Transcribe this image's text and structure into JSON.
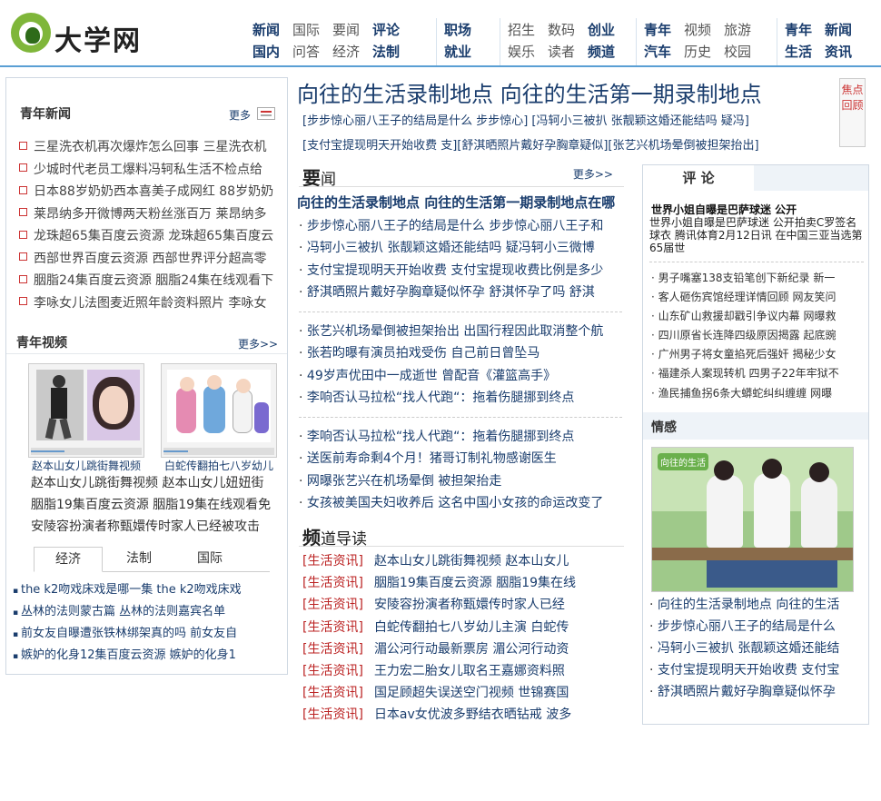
{
  "header": {
    "logo_text": "大学网",
    "nav_cols": [
      {
        "row1": [
          {
            "t": "新闻",
            "b": true
          },
          {
            "t": "国际",
            "b": false
          },
          {
            "t": "要闻",
            "b": false
          },
          {
            "t": "评论",
            "b": true
          }
        ],
        "row2": [
          {
            "t": "国内",
            "b": true
          },
          {
            "t": "问答",
            "b": false
          },
          {
            "t": "经济",
            "b": false
          },
          {
            "t": "法制",
            "b": true
          }
        ]
      },
      {
        "row1": [
          {
            "t": "职场",
            "b": true
          }
        ],
        "row2": [
          {
            "t": "就业",
            "b": true
          }
        ]
      },
      {
        "row1": [
          {
            "t": "招生",
            "b": false
          },
          {
            "t": "数码",
            "b": false
          },
          {
            "t": "创业",
            "b": true
          }
        ],
        "row2": [
          {
            "t": "娱乐",
            "b": false
          },
          {
            "t": "读者",
            "b": false
          },
          {
            "t": "频道",
            "b": true
          }
        ]
      },
      {
        "row1": [
          {
            "t": "青年",
            "b": true
          },
          {
            "t": "视频",
            "b": false
          },
          {
            "t": "旅游",
            "b": false
          }
        ],
        "row2": [
          {
            "t": "汽车",
            "b": true
          },
          {
            "t": "历史",
            "b": false
          },
          {
            "t": "校园",
            "b": false
          }
        ]
      },
      {
        "row1": [
          {
            "t": "青年",
            "b": true
          },
          {
            "t": "新闻",
            "b": true
          }
        ],
        "row2": [
          {
            "t": "生活",
            "b": true
          },
          {
            "t": "资讯",
            "b": true
          }
        ]
      }
    ]
  },
  "left": {
    "youth_news": {
      "title": "青年新闻",
      "more": "更多",
      "items": [
        "三星洗衣机再次爆炸怎么回事 三星洗衣机",
        "少城时代老员工爆料冯轲私生活不检点给",
        "日本88岁奶奶西本喜美子成网红 88岁奶奶",
        "莱昂纳多开微博两天粉丝涨百万 莱昂纳多",
        "龙珠超65集百度云资源 龙珠超65集百度云",
        "西部世界百度云资源 西部世界评分超高零",
        "胭脂24集百度云资源 胭脂24集在线观看下",
        "李咏女儿法图麦近照年龄资料照片 李咏女"
      ]
    },
    "youth_video": {
      "title": "青年视频",
      "more": "更多>>",
      "captions": [
        "赵本山女儿跳街舞视频",
        "白蛇传翻拍七八岁幼儿"
      ],
      "text_lines": [
        "赵本山女儿跳街舞视频 赵本山女儿妞妞街",
        "胭脂19集百度云资源 胭脂19集在线观看免",
        "安陵容扮演者称甄嬛传时家人已经被攻击"
      ]
    },
    "tabs": [
      "经济",
      "法制",
      "国际"
    ],
    "tab_items": [
      "the k2吻戏床戏是哪一集 the k2吻戏床戏",
      "丛林的法则蒙古篇 丛林的法则嘉宾名单",
      "前女友自曝遭张铁林绑架真的吗 前女友自",
      "嫉妒的化身12集百度云资源 嫉妒的化身1"
    ]
  },
  "middle": {
    "headline": "向往的生活录制地点 向往的生活第一期录制地点",
    "links_row1": "[步步惊心丽八王子的结局是什么 步步惊心]   [冯轲小三被扒 张靓颖这婚还能结吗 疑冯]",
    "links_row2": "[支付宝提现明天开始收费 支][舒淇晒照片戴好孕胸章疑似][张艺兴机场晕倒被担架抬出]",
    "focus_label": "焦点回顾",
    "news_head_big": "要",
    "news_head_small": "闻",
    "news_more": "更多>>",
    "top_story": "向往的生活录制地点 向往的生活第一期录制地点在哪",
    "group1": [
      "步步惊心丽八王子的结局是什么 步步惊心丽八王子和",
      "冯轲小三被扒 张靓颖这婚还能结吗 疑冯轲小三微博",
      "支付宝提现明天开始收费 支付宝提现收费比例是多少",
      "舒淇晒照片戴好孕胸章疑似怀孕 舒淇怀孕了吗 舒淇"
    ],
    "group2": [
      "张艺兴机场晕倒被担架抬出 出国行程因此取消整个航",
      "张若昀曝有演员拍戏受伤 自己前日曾坠马",
      "49岁声优田中一成逝世 曾配音《灌篮高手》",
      "李响否认马拉松“找人代跑“：拖着伤腿挪到终点"
    ],
    "group3": [
      "李响否认马拉松“找人代跑“：拖着伤腿挪到终点",
      "送医前寿命剩4个月！猪哥订制礼物感谢医生",
      "网曝张艺兴在机场晕倒 被担架抬走",
      "女孩被美国夫妇收养后 这名中国小女孩的命运改变了"
    ],
    "channel_head_big": "频",
    "channel_head_small": "道导读",
    "channel_items": [
      {
        "c": "[生活资讯]",
        "t": "赵本山女儿跳街舞视频 赵本山女儿"
      },
      {
        "c": "[生活资讯]",
        "t": "胭脂19集百度云资源 胭脂19集在线"
      },
      {
        "c": "[生活资讯]",
        "t": "安陵容扮演者称甄嬛传时家人已经"
      },
      {
        "c": "[生活资讯]",
        "t": "白蛇传翻拍七八岁幼儿主演 白蛇传"
      },
      {
        "c": "[生活资讯]",
        "t": "湄公河行动最新票房 湄公河行动资"
      },
      {
        "c": "[生活资讯]",
        "t": "王力宏二胎女儿取名王嘉娜资料照"
      },
      {
        "c": "[生活资讯]",
        "t": "国足顾超失误送空门视频 世锦赛国"
      },
      {
        "c": "[生活资讯]",
        "t": "日本av女优波多野结衣晒钻戒 波多"
      }
    ]
  },
  "right": {
    "tab_comment": "评 论",
    "hl_title": "世界小姐自曝是巴萨球迷 公开",
    "hl_summary": "世界小姐自曝是巴萨球迷 公开拍卖C罗签名球衣 腾讯体育2月12日讯 在中国三亚当选第65届世",
    "items": [
      "男子嘴塞138支铅笔创下新纪录 新一",
      "客人砸伤宾馆经理详情回顾 网友笑问",
      "山东矿山救援却戳引争议内幕 网曝救",
      "四川原省长连降四级原因揭露 起底豌",
      "广州男子将女童掐死后强奸 揭秘少女",
      "福建杀人案现转机 四男子22年牢狱不",
      "渔民捕鱼拐6条大蟒蛇纠纠缠缠 网曝"
    ],
    "emotion_title": "情感",
    "photo_badge": "向往的生活",
    "emotion_items": [
      "向往的生活录制地点 向往的生活",
      "步步惊心丽八王子的结局是什么",
      "冯轲小三被扒 张靓颖这婚还能结",
      "支付宝提现明天开始收费 支付宝",
      "舒淇晒照片戴好孕胸章疑似怀孕"
    ]
  },
  "colors": {
    "accent": "#5a9fd4",
    "link": "#1a3d6d",
    "tag": "#b22"
  }
}
